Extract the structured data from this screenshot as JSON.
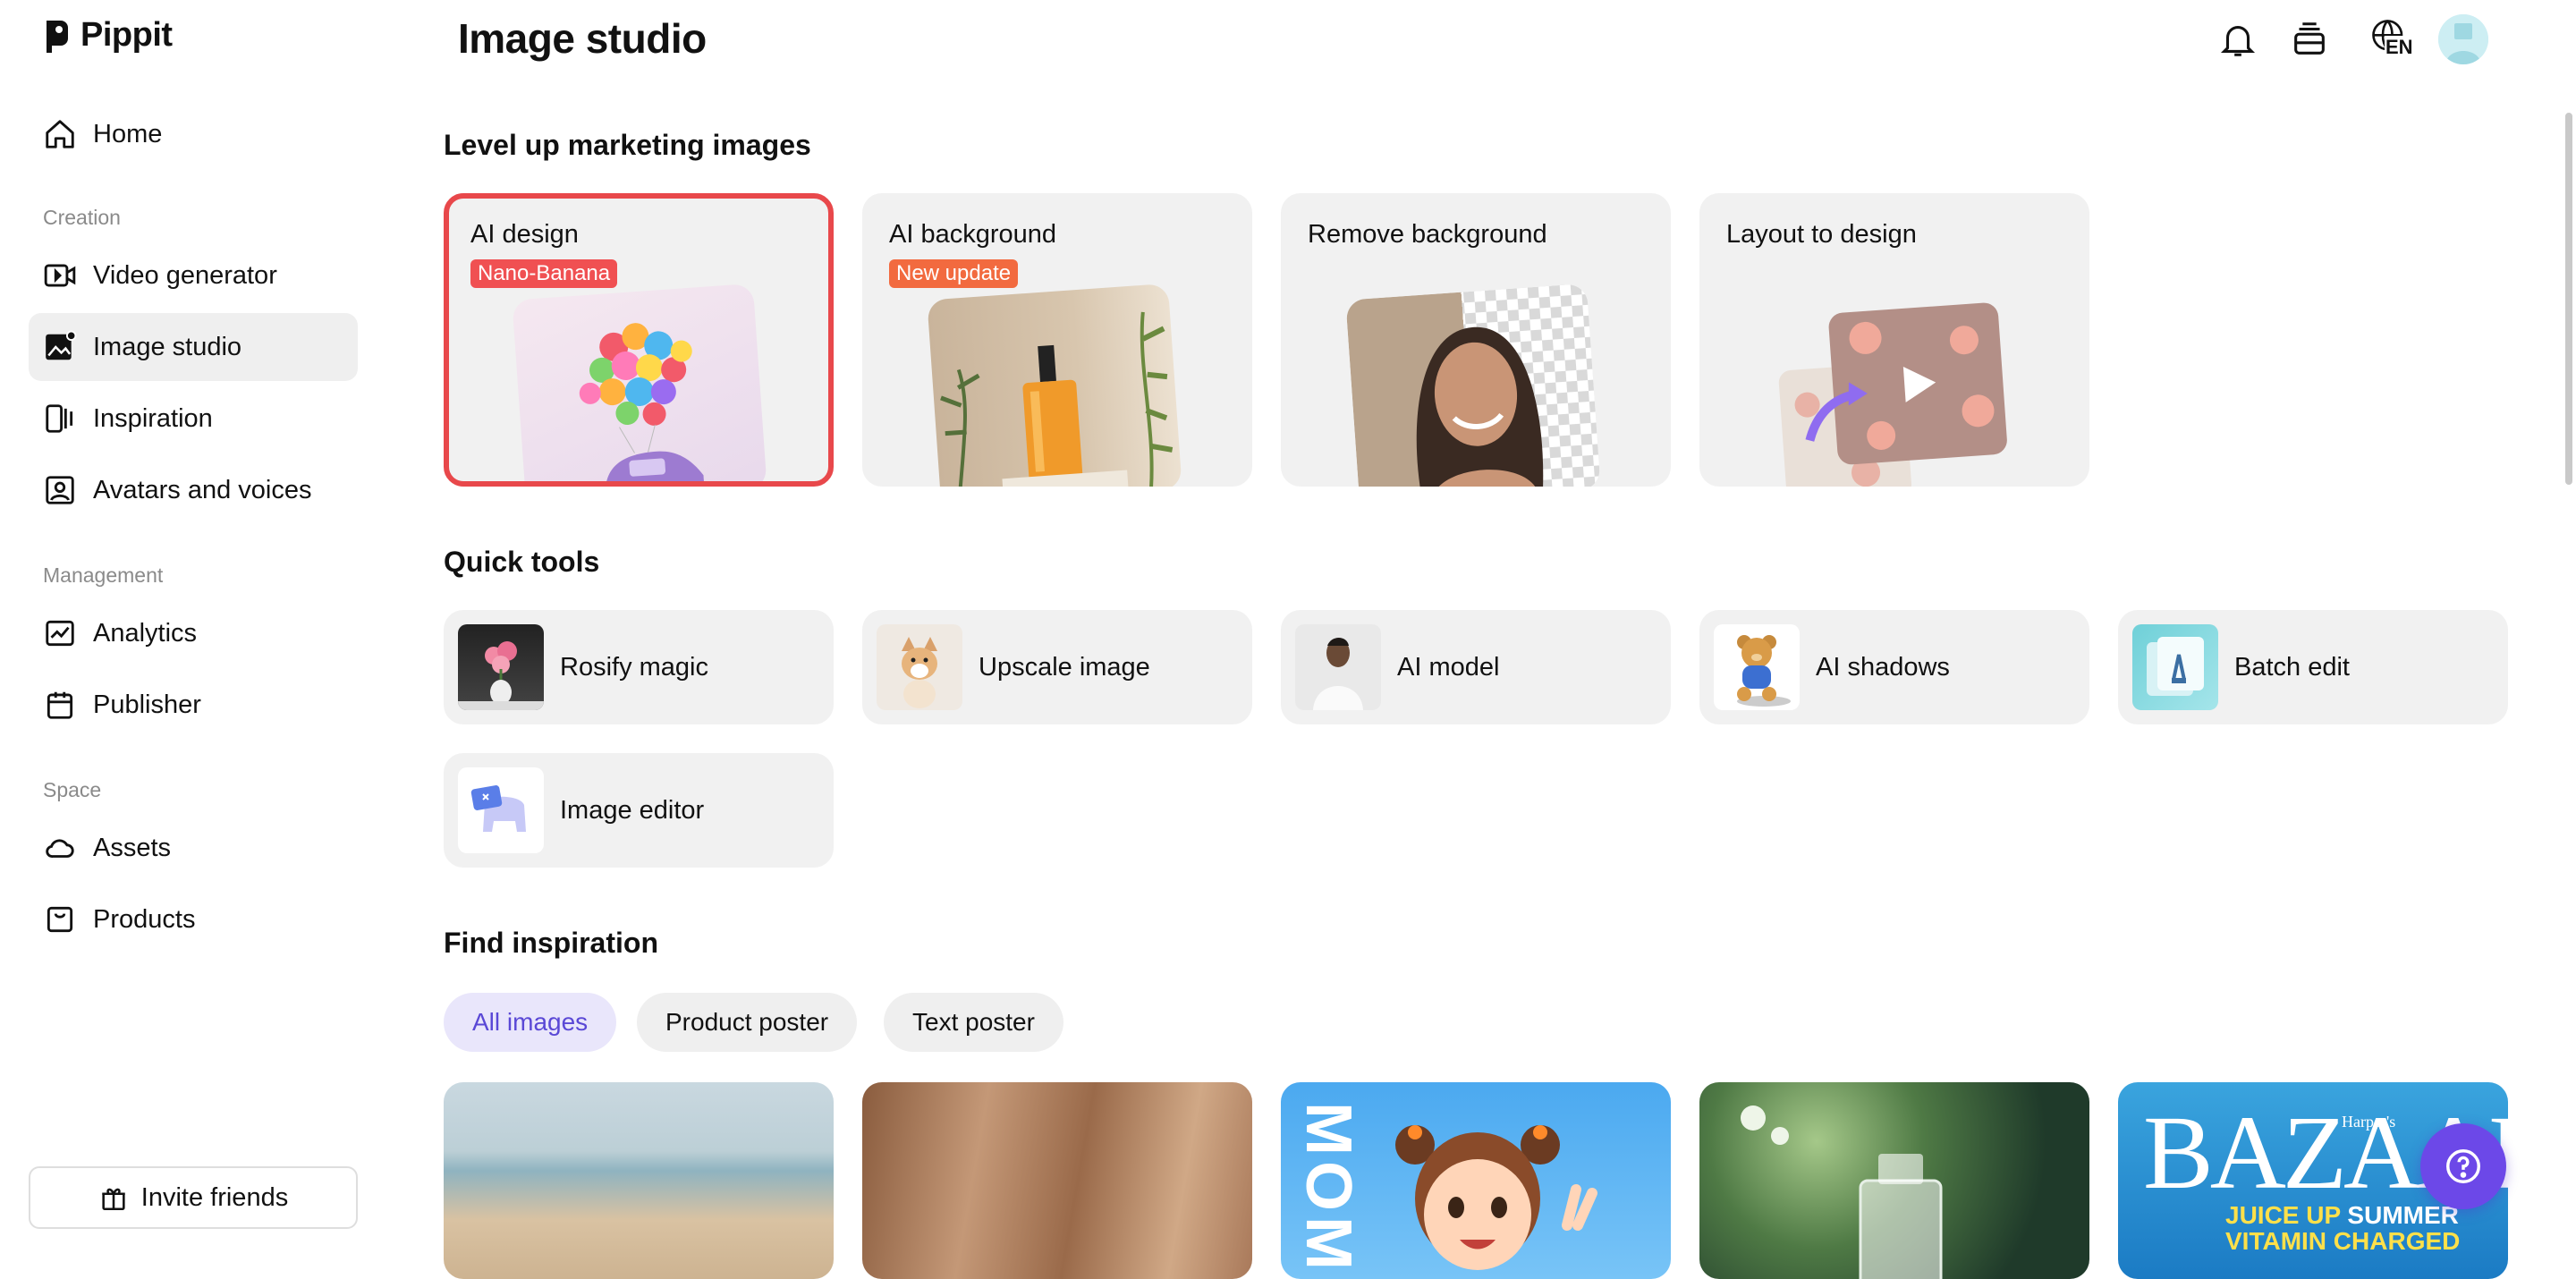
{
  "app": {
    "name": "Pippit"
  },
  "sidebar": {
    "home": "Home",
    "section_creation": "Creation",
    "video_generator": "Video generator",
    "image_studio": "Image studio",
    "inspiration": "Inspiration",
    "avatars_voices": "Avatars and voices",
    "section_management": "Management",
    "analytics": "Analytics",
    "publisher": "Publisher",
    "section_space": "Space",
    "assets": "Assets",
    "products": "Products",
    "invite": "Invite friends"
  },
  "header": {
    "title": "Image studio",
    "language": "EN"
  },
  "marketing": {
    "title": "Level up marketing images",
    "cards": [
      {
        "title": "AI design",
        "badge": "Nano-Banana"
      },
      {
        "title": "AI background",
        "badge": "New update"
      },
      {
        "title": "Remove background"
      },
      {
        "title": "Layout to design"
      }
    ]
  },
  "quick_tools": {
    "title": "Quick tools",
    "items": [
      "Rosify magic",
      "Upscale image",
      "AI model",
      "AI shadows",
      "Batch edit",
      "Image editor"
    ]
  },
  "inspiration": {
    "title": "Find inspiration",
    "filters": [
      "All images",
      "Product poster",
      "Text poster"
    ],
    "poster_text": {
      "mom": "MOM",
      "bazaar": "BAZAAR",
      "harpers": "Harper's",
      "juice": "JUICE UP",
      "summer": "SUMMER",
      "vitamin": "VITAMIN CHARGED"
    }
  },
  "colors": {
    "accent": "#6c48e8",
    "selected_border": "#e8484b",
    "badge_red": "#f05052",
    "badge_orange": "#f26a3f"
  }
}
